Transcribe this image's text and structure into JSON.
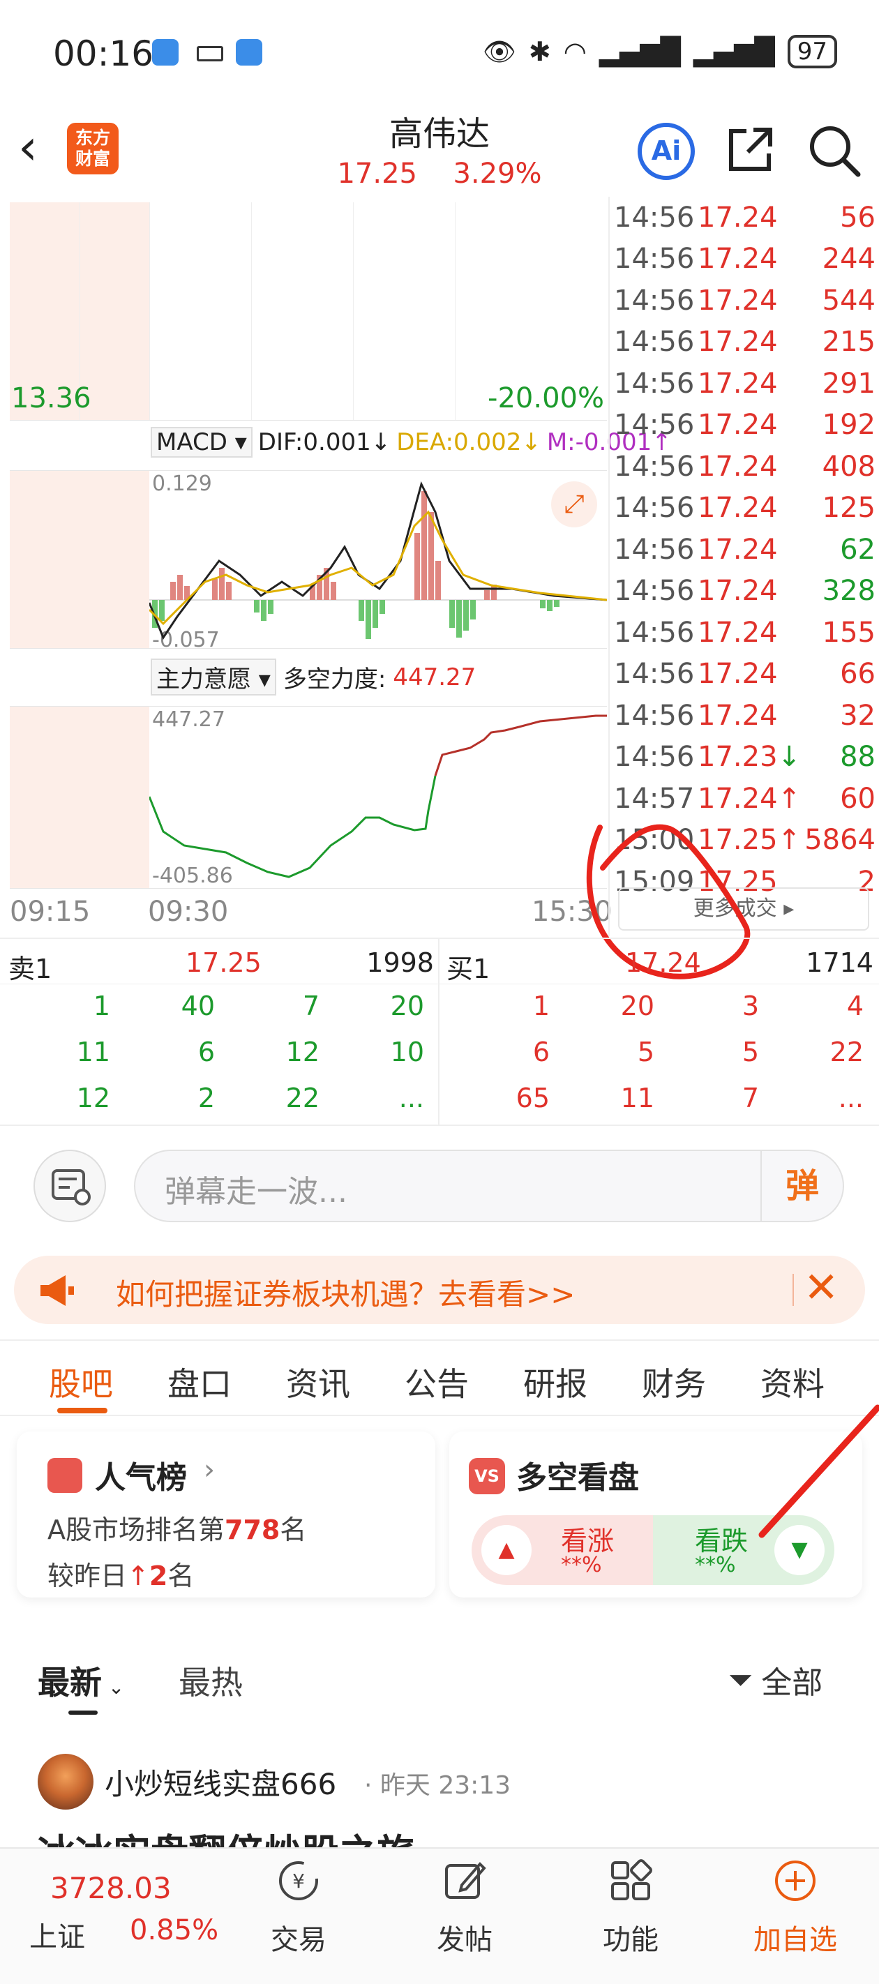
{
  "status_bar": {
    "time": "00:16",
    "battery": "97"
  },
  "header": {
    "logo_line1": "东方",
    "logo_line2": "财富",
    "title": "高伟达",
    "price": "17.25",
    "change_pct": "3.29%",
    "ai_label": "Ai"
  },
  "chart": {
    "price_low_label": "13.36",
    "pct_low_label": "-20.00%",
    "macd_selector": "MACD",
    "dif": "DIF:0.001",
    "dea": "DEA:0.002",
    "m": "M:-0.001",
    "macd_top": "0.129",
    "macd_bottom": "-0.057",
    "force_selector": "主力意愿",
    "force_label": "多空力度:",
    "force_value": "447.27",
    "force_top": "447.27",
    "force_bottom": "-405.86",
    "time_start": "09:15",
    "time_open": "09:30",
    "time_close": "15:30",
    "colors": {
      "dif": "#222222",
      "dea": "#e0b000",
      "m": "#b02fc0",
      "up": "#e0312a",
      "down": "#1c9a2c"
    }
  },
  "trades": {
    "rows": [
      {
        "time": "14:56",
        "price": "17.24",
        "vol": "56",
        "dir": "",
        "vol_color": "red"
      },
      {
        "time": "14:56",
        "price": "17.24",
        "vol": "244",
        "dir": "",
        "vol_color": "red"
      },
      {
        "time": "14:56",
        "price": "17.24",
        "vol": "544",
        "dir": "",
        "vol_color": "red"
      },
      {
        "time": "14:56",
        "price": "17.24",
        "vol": "215",
        "dir": "",
        "vol_color": "red"
      },
      {
        "time": "14:56",
        "price": "17.24",
        "vol": "291",
        "dir": "",
        "vol_color": "red"
      },
      {
        "time": "14:56",
        "price": "17.24",
        "vol": "192",
        "dir": "",
        "vol_color": "red"
      },
      {
        "time": "14:56",
        "price": "17.24",
        "vol": "408",
        "dir": "",
        "vol_color": "red"
      },
      {
        "time": "14:56",
        "price": "17.24",
        "vol": "125",
        "dir": "",
        "vol_color": "red"
      },
      {
        "time": "14:56",
        "price": "17.24",
        "vol": "62",
        "dir": "",
        "vol_color": "green"
      },
      {
        "time": "14:56",
        "price": "17.24",
        "vol": "328",
        "dir": "",
        "vol_color": "green"
      },
      {
        "time": "14:56",
        "price": "17.24",
        "vol": "155",
        "dir": "",
        "vol_color": "red"
      },
      {
        "time": "14:56",
        "price": "17.24",
        "vol": "66",
        "dir": "",
        "vol_color": "red"
      },
      {
        "time": "14:56",
        "price": "17.24",
        "vol": "32",
        "dir": "",
        "vol_color": "red"
      },
      {
        "time": "14:56",
        "price": "17.23",
        "vol": "88",
        "dir": "↓",
        "vol_color": "green"
      },
      {
        "time": "14:57",
        "price": "17.24",
        "vol": "60",
        "dir": "↑",
        "vol_color": "red"
      },
      {
        "time": "15:00",
        "price": "17.25",
        "vol": "5864",
        "dir": "↑",
        "vol_color": "red"
      },
      {
        "time": "15:09",
        "price": "17.25",
        "vol": "2",
        "dir": "",
        "vol_color": "red"
      }
    ],
    "more_label": "更多成交"
  },
  "order_book": {
    "sell_label": "卖1",
    "sell_price": "17.25",
    "sell_vol": "1998",
    "buy_label": "买1",
    "buy_price": "17.24",
    "buy_vol": "1714",
    "sell_queue": [
      [
        "1",
        "40",
        "7",
        "20"
      ],
      [
        "11",
        "6",
        "12",
        "10"
      ],
      [
        "12",
        "2",
        "22",
        "..."
      ]
    ],
    "buy_queue": [
      [
        "1",
        "20",
        "3",
        "4"
      ],
      [
        "6",
        "5",
        "5",
        "22"
      ],
      [
        "65",
        "11",
        "7",
        "..."
      ]
    ]
  },
  "danmaku": {
    "placeholder": "弹幕走一波...",
    "button": "弹"
  },
  "banner": {
    "text": "如何把握证券板块机遇？去看看>>"
  },
  "tabs": [
    "股吧",
    "盘口",
    "资讯",
    "公告",
    "研报",
    "财务",
    "资料"
  ],
  "popularity": {
    "title": "人气榜",
    "rank_prefix": "A股市场排名第",
    "rank": "778",
    "rank_suffix": "名",
    "change_prefix": "较昨日",
    "change_value": "2",
    "change_suffix": "名"
  },
  "sentiment": {
    "title": "多空看盘",
    "badge": "VS",
    "bull_label": "看涨",
    "bull_value": "**%",
    "bear_label": "看跌",
    "bear_value": "**%"
  },
  "feed": {
    "tab_latest": "最新",
    "tab_hot": "最热",
    "filter_label": "全部",
    "post_user": "小炒短线实盘666",
    "post_time": "昨天 23:13",
    "post_title": "冰冰实盘翻倍炒股之旅"
  },
  "bottom_nav": {
    "index_value": "3728.03",
    "index_name": "上证",
    "index_change": "0.85%",
    "trade": "交易",
    "post": "发帖",
    "functions": "功能",
    "add_watch": "加自选"
  }
}
